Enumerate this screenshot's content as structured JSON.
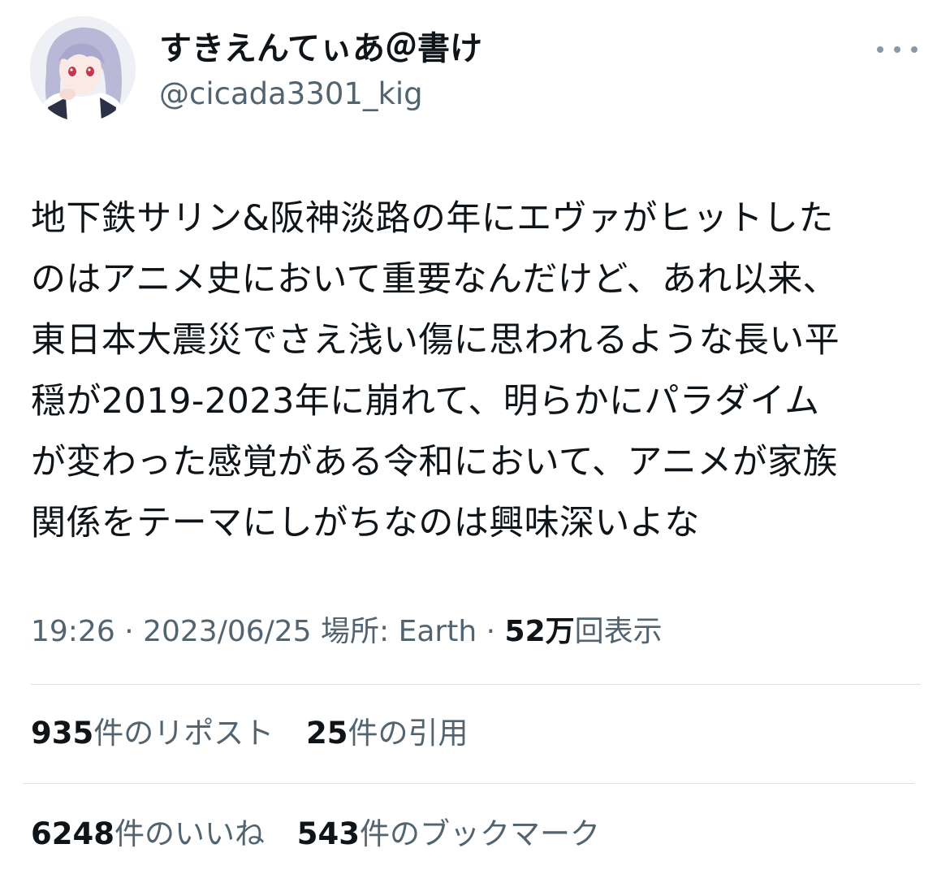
{
  "user": {
    "display_name": "すきえんてぃあ＠書け",
    "handle": "@cicada3301_kig"
  },
  "tweet": {
    "lines": [
      "地下鉄サリン&阪神淡路の年にエヴァがヒットした",
      "のはアニメ史において重要なんだけど、あれ以来、",
      "東日本大震災でさえ浅い傷に思われるような長い平",
      "穏が2019-2023年に崩れて、明らかにパラダイム",
      "が変わった感覚がある令和において、アニメが家族",
      "関係をテーマにしがちなのは興味深いよな"
    ]
  },
  "meta": {
    "time": "19:26",
    "separator": " · ",
    "date": "2023/06/25",
    "location_label": "場所: Earth",
    "views_count": "52万",
    "views_label": "回表示"
  },
  "stats": {
    "reposts": {
      "count": "935",
      "label": "件のリポスト"
    },
    "quotes": {
      "count": "25",
      "label": "件の引用"
    },
    "likes": {
      "count": "6248",
      "label": "件のいいね"
    },
    "bookmarks": {
      "count": "543",
      "label": "件のブックマーク"
    }
  },
  "icons": {
    "more": "more-horizontal-icon",
    "avatar": "profile-avatar"
  },
  "colors": {
    "primary_text": "#0f1419",
    "secondary_text": "#536471",
    "divider": "#dfe3e7",
    "more_dots": "#8b98a5"
  }
}
